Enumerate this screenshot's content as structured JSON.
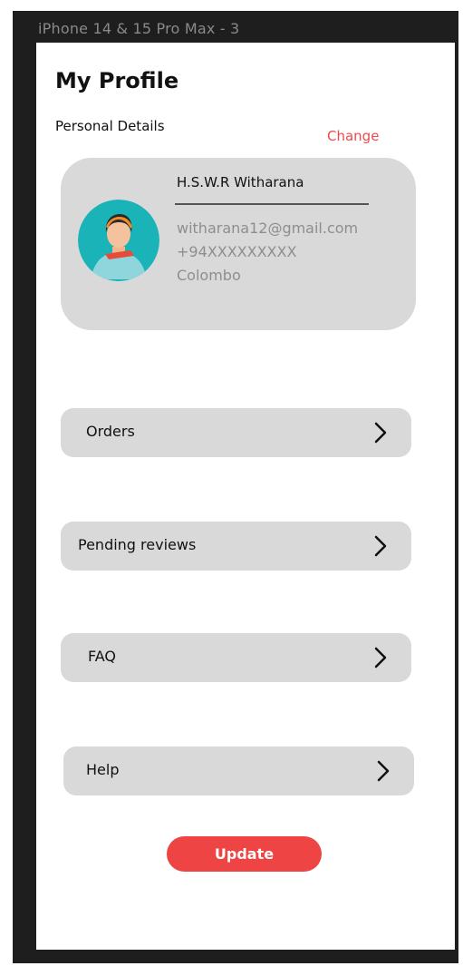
{
  "frame": {
    "label": "iPhone 14 & 15 Pro Max - 3"
  },
  "header": {
    "title": "My Profile"
  },
  "personal": {
    "section_label": "Personal Details",
    "change_label": "Change",
    "name": "H.S.W.R Witharana",
    "email": "witharana12@gmail.com",
    "phone": "+94XXXXXXXXX",
    "city": "Colombo"
  },
  "menu": {
    "items": [
      {
        "label": "Orders",
        "icon": "chevron-right-icon"
      },
      {
        "label": "Pending reviews",
        "icon": "chevron-right-icon"
      },
      {
        "label": "FAQ",
        "icon": "chevron-right-icon"
      },
      {
        "label": "Help",
        "icon": "chevron-right-icon"
      }
    ]
  },
  "actions": {
    "update_label": "Update"
  },
  "colors": {
    "accent": "#ee4444",
    "card_bg": "#d9d9d9",
    "avatar_bg": "#1ab3b8"
  }
}
